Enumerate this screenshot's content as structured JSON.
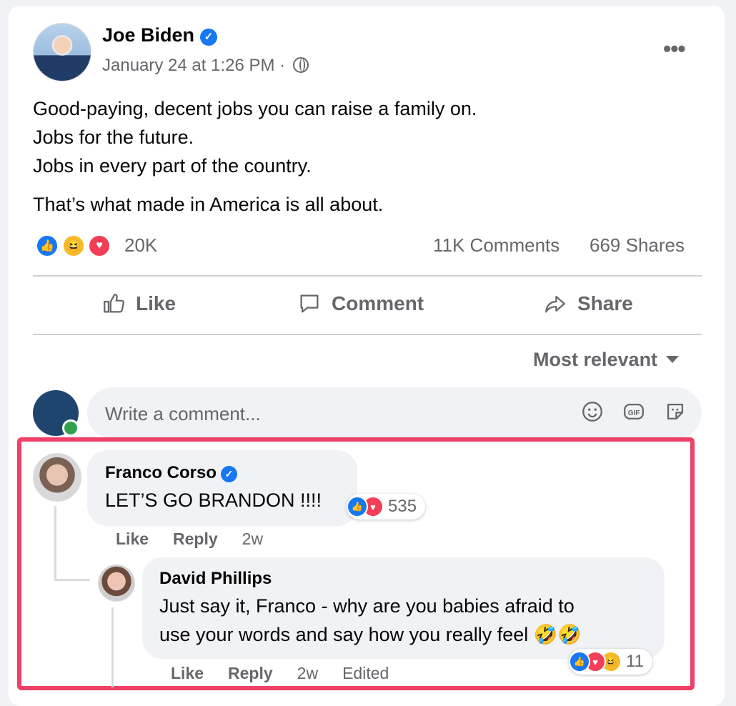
{
  "post": {
    "author": "Joe Biden",
    "timestamp": "January 24 at 1:26 PM",
    "separator": "·",
    "more": "•••",
    "lines": [
      "Good-paying, decent jobs you can raise a family on.",
      "Jobs for the future.",
      "Jobs in every part of the country."
    ],
    "closing": "That’s what made in America is all about.",
    "reactions_count": "20K",
    "comments_count": "11K Comments",
    "shares_count": "669 Shares"
  },
  "actions": {
    "like": "Like",
    "comment": "Comment",
    "share": "Share"
  },
  "sort_label": "Most relevant",
  "composer": {
    "placeholder": "Write a comment..."
  },
  "comments": [
    {
      "author": "Franco Corso",
      "text": "LET’S GO BRANDON !!!!",
      "reactions": "535",
      "like": "Like",
      "reply": "Reply",
      "time": "2w"
    },
    {
      "author": "David Phillips",
      "text_line1": "Just say it, Franco - why are you babies afraid to",
      "text_line2": "use your words and say how you really feel 🤣🤣",
      "reactions": "11",
      "like": "Like",
      "reply": "Reply",
      "time": "2w",
      "edited": "Edited"
    }
  ],
  "colors": {
    "brand": "#1877f2",
    "highlight": "#ef4068",
    "muted": "#65676b"
  }
}
